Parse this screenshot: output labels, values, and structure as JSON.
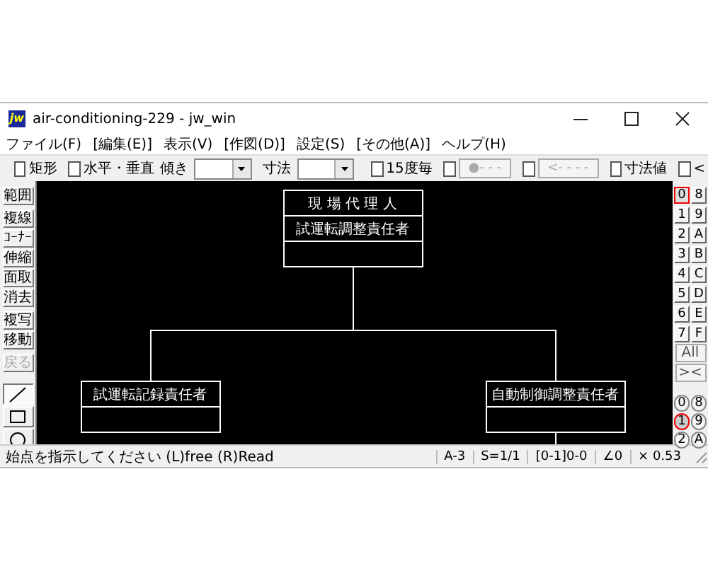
{
  "window": {
    "title": "air-conditioning-229 - jw_win",
    "icon_label": "jw"
  },
  "menu": [
    "ファイル(F)",
    "[編集(E)]",
    "表示(V)",
    "[作図(D)]",
    "設定(S)",
    "[その他(A)]",
    "ヘルプ(H)"
  ],
  "toolbar": [
    {
      "kind": "checkbox",
      "label": "矩形",
      "checked": false
    },
    {
      "kind": "checkbox",
      "label": "水平・垂直",
      "checked": false
    },
    {
      "kind": "dropdown",
      "label": "傾き"
    },
    {
      "kind": "dropdown",
      "label": "寸法"
    },
    {
      "kind": "checkbox",
      "label": "15度毎",
      "checked": false
    },
    {
      "kind": "checkbutton",
      "button": "●- - -",
      "checked": false,
      "disabled": true
    },
    {
      "kind": "checkbutton",
      "button": "<- - - -",
      "checked": false,
      "disabled": true
    },
    {
      "kind": "checkbox",
      "label": "寸法値",
      "checked": false
    },
    {
      "kind": "checkbox",
      "label": "<",
      "checked": false
    }
  ],
  "left_tools": [
    [
      {
        "label": "範囲",
        "disabled": false
      }
    ],
    [
      {
        "label": "複線",
        "disabled": false
      },
      {
        "label": "ｺｰﾅｰ",
        "disabled": false
      },
      {
        "label": "伸縮",
        "disabled": false
      },
      {
        "label": "面取",
        "disabled": false
      },
      {
        "label": "消去",
        "disabled": false
      }
    ],
    [
      {
        "label": "複写",
        "disabled": false
      },
      {
        "label": "移動",
        "disabled": false
      }
    ],
    [
      {
        "label": "戻る",
        "disabled": true
      }
    ]
  ],
  "draw_tools": [
    {
      "selected": true
    },
    {
      "selected": false
    },
    {
      "selected": false
    }
  ],
  "diagram": {
    "boxes": [
      {
        "texts": [
          "現 場 代 理 人",
          "試運転調整責任者"
        ]
      },
      {
        "texts": [
          "試運転記録責任者"
        ]
      },
      {
        "texts": [
          "自動制御調整責任者"
        ]
      }
    ]
  },
  "layer_groups": [
    {
      "label": "0",
      "selected": true
    },
    {
      "label": "8",
      "selected": false
    },
    {
      "label": "1",
      "selected": false
    },
    {
      "label": "9",
      "selected": false
    },
    {
      "label": "2",
      "selected": false
    },
    {
      "label": "A",
      "selected": false
    },
    {
      "label": "3",
      "selected": false
    },
    {
      "label": "B",
      "selected": false
    },
    {
      "label": "4",
      "selected": false
    },
    {
      "label": "C",
      "selected": false
    },
    {
      "label": "5",
      "selected": false
    },
    {
      "label": "D",
      "selected": false
    },
    {
      "label": "6",
      "selected": false
    },
    {
      "label": "E",
      "selected": false
    },
    {
      "label": "7",
      "selected": false
    },
    {
      "label": "F",
      "selected": false
    }
  ],
  "layer_buttons": [
    "All",
    "><"
  ],
  "layers": [
    {
      "label": "0",
      "selected": false
    },
    {
      "label": "8",
      "selected": false
    },
    {
      "label": "1",
      "selected": true
    },
    {
      "label": "9",
      "selected": false
    },
    {
      "label": "2",
      "selected": false
    },
    {
      "label": "A",
      "selected": false
    }
  ],
  "status_bar": {
    "message": "始点を指示してください (L)free (R)Read",
    "fields": [
      "A-3",
      "S=1/1",
      "[0-1]0-0",
      "∠0",
      "× 0.53"
    ]
  }
}
